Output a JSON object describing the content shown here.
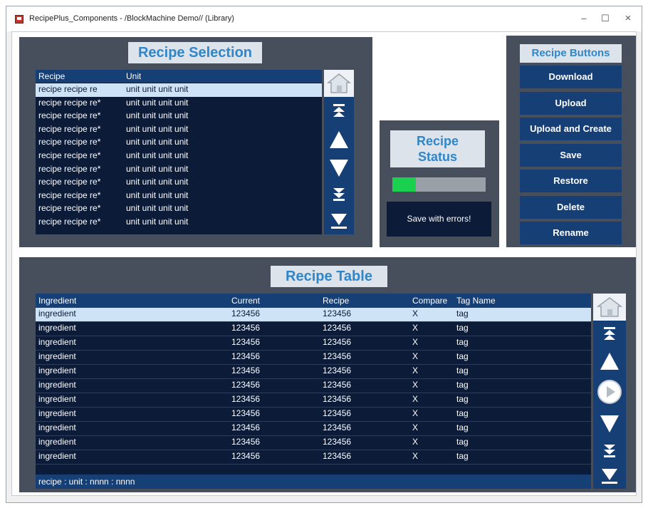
{
  "window": {
    "title": "RecipePlus_Components - /BlockMachine Demo// (Library)",
    "minimize_glyph": "–",
    "maximize_glyph": "☐",
    "close_glyph": "×"
  },
  "recipe_selection": {
    "title": "Recipe Selection",
    "columns": [
      "Recipe",
      "Unit"
    ],
    "rows": [
      {
        "recipe": "recipe recipe re*",
        "unit": "unit unit unit unit"
      },
      {
        "recipe": "recipe recipe re*",
        "unit": "unit unit unit unit"
      },
      {
        "recipe": "recipe recipe re*",
        "unit": "unit unit unit unit"
      },
      {
        "recipe": "recipe recipe re*",
        "unit": "unit unit unit unit"
      },
      {
        "recipe": "recipe recipe re*",
        "unit": "unit unit unit unit"
      },
      {
        "recipe": "recipe recipe re*",
        "unit": "unit unit unit unit"
      },
      {
        "recipe": "recipe recipe re*",
        "unit": "unit unit unit unit"
      },
      {
        "recipe": "recipe recipe re*",
        "unit": "unit unit unit unit"
      },
      {
        "recipe": "recipe recipe re*",
        "unit": "unit unit unit unit"
      },
      {
        "recipe": "recipe recipe re*",
        "unit": "unit unit unit unit"
      },
      {
        "recipe": "recipe recipe re*",
        "unit": "unit unit unit unit"
      }
    ],
    "first_row_recipe": "recipe recipe re",
    "selected_index": 0,
    "nav_icons": [
      "home-icon",
      "double-up-arrow-icon",
      "up-arrow-icon",
      "down-arrow-icon",
      "double-down-arrow-icon",
      "last-arrow-icon"
    ]
  },
  "recipe_status": {
    "title_line1": "Recipe",
    "title_line2": "Status",
    "progress": 0.25,
    "message": "Save with errors!",
    "progress_color": "#19d14f"
  },
  "recipe_buttons": {
    "title": "Recipe Buttons",
    "buttons": [
      "Download",
      "Upload",
      "Upload and Create",
      "Save",
      "Restore",
      "Delete",
      "Rename"
    ]
  },
  "recipe_table": {
    "title": "Recipe Table",
    "columns": [
      "Ingredient",
      "Current",
      "Recipe",
      "Compare",
      "Tag Name"
    ],
    "rows": [
      {
        "ingredient": "ingredient",
        "current": "123456",
        "recipe": "123456",
        "compare": "X",
        "tag": "tag"
      },
      {
        "ingredient": "ingredient",
        "current": "123456",
        "recipe": "123456",
        "compare": "X",
        "tag": "tag"
      },
      {
        "ingredient": "ingredient",
        "current": "123456",
        "recipe": "123456",
        "compare": "X",
        "tag": "tag"
      },
      {
        "ingredient": "ingredient",
        "current": "123456",
        "recipe": "123456",
        "compare": "X",
        "tag": "tag"
      },
      {
        "ingredient": "ingredient",
        "current": "123456",
        "recipe": "123456",
        "compare": "X",
        "tag": "tag"
      },
      {
        "ingredient": "ingredient",
        "current": "123456",
        "recipe": "123456",
        "compare": "X",
        "tag": "tag"
      },
      {
        "ingredient": "ingredient",
        "current": "123456",
        "recipe": "123456",
        "compare": "X",
        "tag": "tag"
      },
      {
        "ingredient": "ingredient",
        "current": "123456",
        "recipe": "123456",
        "compare": "X",
        "tag": "tag"
      },
      {
        "ingredient": "ingredient",
        "current": "123456",
        "recipe": "123456",
        "compare": "X",
        "tag": "tag"
      },
      {
        "ingredient": "ingredient",
        "current": "123456",
        "recipe": "123456",
        "compare": "X",
        "tag": "tag"
      },
      {
        "ingredient": "ingredient",
        "current": "123456",
        "recipe": "123456",
        "compare": "X",
        "tag": "tag"
      }
    ],
    "selected_index": 0,
    "footer": "recipe : unit : nnnn : nnnn",
    "nav_icons": [
      "home-icon",
      "double-up-arrow-icon",
      "up-arrow-icon",
      "play-circle-icon",
      "down-arrow-icon",
      "double-down-arrow-icon",
      "last-arrow-icon"
    ]
  },
  "colors": {
    "panel": "#474f5c",
    "grid": "#0b1b38",
    "header": "#163f75",
    "accent_text": "#2f86c8",
    "selection": "#cfe3f7"
  }
}
